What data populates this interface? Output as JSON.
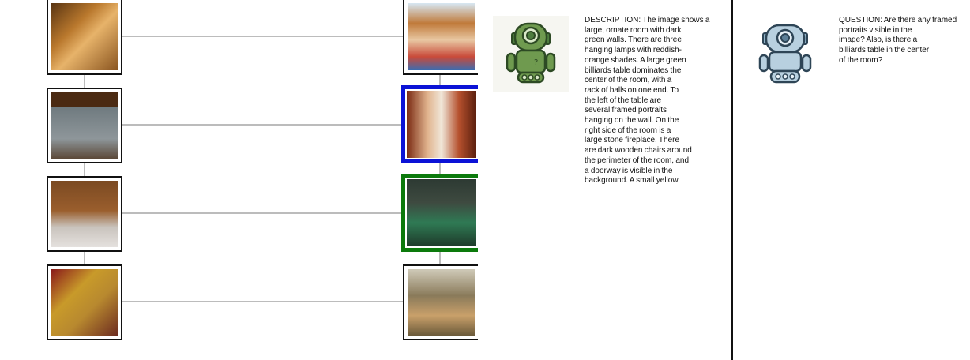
{
  "left_images": [
    {
      "icon": "dining-room-photo"
    },
    {
      "icon": "empty-room-photo"
    },
    {
      "icon": "walk-in-closet-photo"
    },
    {
      "icon": "red-living-room-photo"
    }
  ],
  "right_images": [
    {
      "icon": "classroom-photo"
    },
    {
      "icon": "hallway-photo",
      "highlight": "#0b12d6"
    },
    {
      "icon": "billiards-room-photo",
      "highlight": "#0c7a0c"
    },
    {
      "icon": "storage-room-photo"
    }
  ],
  "agent1": {
    "icon": "green-robot-icon",
    "description": "DESCRIPTION: The image shows a\nlarge, ornate room with dark\ngreen walls. There are three\nhanging lamps with reddish-\norange shades. A large green\nbilliards table dominates the\ncenter of the room, with a\nrack of balls on one end. To\nthe left of the table are\nseveral framed portraits\nhanging on the wall. On the\nright side of the room is a\nlarge stone fireplace. There\nare dark wooden chairs around\nthe perimeter of the room, and\na doorway is visible in the\nbackground. A small yellow"
  },
  "agent2": {
    "icon": "blue-robot-icon",
    "question": "QUESTION: Are there any framed\nportraits visible in the\nimage? Also, is there a\nbilliards table in the center\nof the room?"
  }
}
